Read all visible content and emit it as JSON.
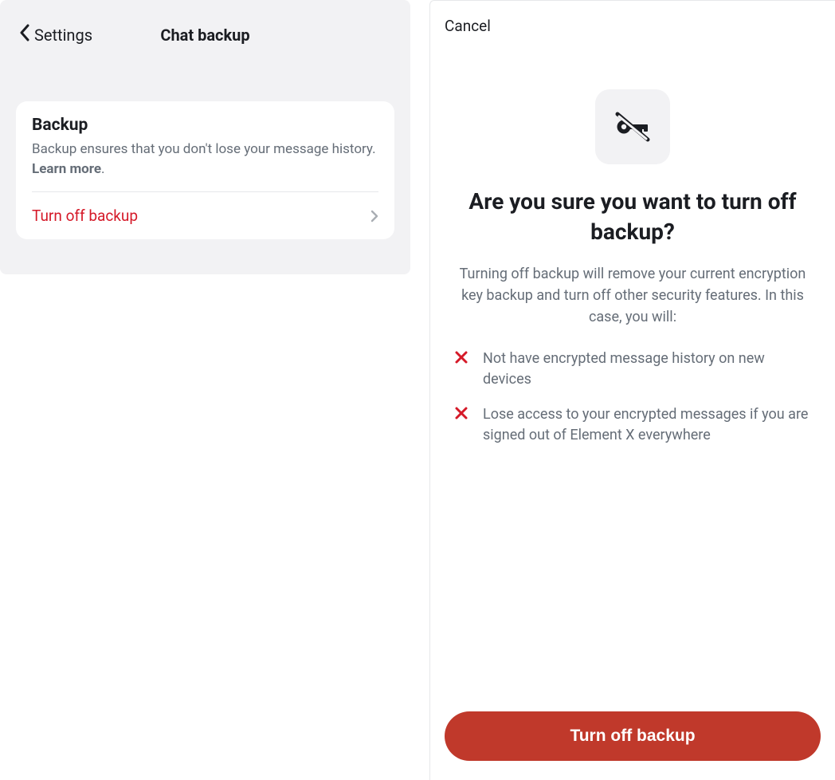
{
  "left": {
    "back_label": "Settings",
    "title": "Chat backup",
    "card": {
      "heading": "Backup",
      "desc_prefix": "Backup ensures that you don't lose your message history. ",
      "learn_more": "Learn more",
      "desc_suffix": "."
    },
    "turn_off_row": "Turn off backup"
  },
  "modal": {
    "cancel": "Cancel",
    "title": "Are you sure you want to turn off backup?",
    "description": "Turning off backup will remove your current encryption key backup and turn off other security features. In this case, you will:",
    "warnings": [
      "Not have encrypted message history on new devices",
      "Lose access to your encrypted messages if you are signed out of Element X everywhere"
    ],
    "confirm_button": "Turn off backup"
  },
  "colors": {
    "danger": "#d51928",
    "danger_button": "#c0392b",
    "muted": "#656d77",
    "panel_bg": "#f2f2f4"
  }
}
